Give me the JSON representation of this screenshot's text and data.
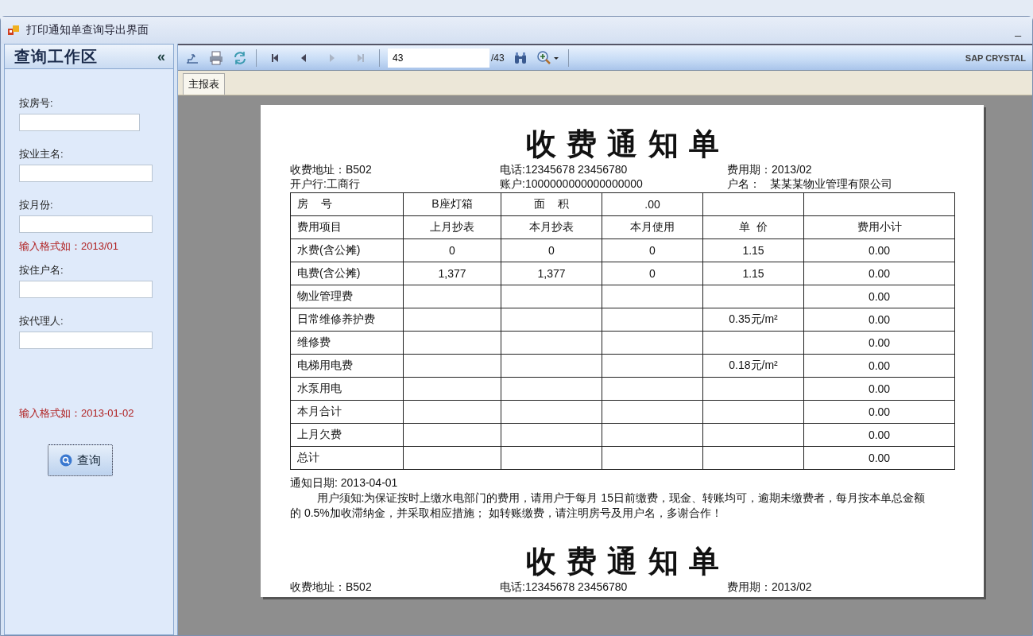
{
  "window": {
    "title": "打印通知单查询导出界面",
    "minimize": "_"
  },
  "sidebar": {
    "title": "查询工作区",
    "collapse": "«",
    "fields": [
      {
        "label": "按房号:"
      },
      {
        "label": "按业主名:"
      },
      {
        "label": "按月份:",
        "hint": "输入格式如：2013/01"
      },
      {
        "label": "按住户名:"
      },
      {
        "label": "按代理人:"
      }
    ],
    "date_hint": "输入格式如：2013-01-02",
    "button": "查询"
  },
  "toolbar": {
    "nav": [
      {
        "kind": "first",
        "disabled": false
      },
      {
        "kind": "prev",
        "disabled": false
      },
      {
        "kind": "next",
        "disabled": true
      },
      {
        "kind": "last",
        "disabled": true
      }
    ],
    "page_value": "43",
    "page_total": "/43",
    "brand": "SAP CRYSTAL"
  },
  "tabs": [
    {
      "label": "主报表",
      "selected": true
    }
  ],
  "pages": [
    {
      "title": "收 费 通 知 单",
      "info": [
        [
          "收费地址：B502",
          "电话:12345678 23456780",
          "费用期：2013/02"
        ],
        [
          "开户行:工商行",
          "账户:1000000000000000000",
          "户名：   某某某物业管理有限公司"
        ]
      ],
      "table": {
        "rows": [
          [
            "房    号",
            "B座灯箱",
            "面    积",
            ".00",
            null,
            null
          ],
          [
            "费用项目",
            "上月抄表",
            "本月抄表",
            "本月使用",
            "单  价",
            "费用小计"
          ],
          [
            "水费(含公摊)",
            "0",
            "0",
            "0",
            "1.15",
            "0.00"
          ],
          [
            "电费(含公摊)",
            "1,377",
            "1,377",
            "0",
            "1.15",
            "0.00"
          ],
          [
            "物业管理费",
            null,
            null,
            null,
            null,
            "0.00"
          ],
          [
            "日常维修养护费",
            null,
            null,
            null,
            "0.35元/m²",
            "0.00"
          ],
          [
            "维修费",
            null,
            null,
            null,
            null,
            "0.00"
          ],
          [
            "电梯用电费",
            null,
            null,
            null,
            "0.18元/m²",
            "0.00"
          ],
          [
            "水泵用电",
            null,
            null,
            null,
            null,
            "0.00"
          ],
          [
            "本月合计",
            null,
            null,
            null,
            null,
            "0.00"
          ],
          [
            "上月欠费",
            null,
            null,
            null,
            null,
            "0.00"
          ],
          [
            "总计",
            null,
            null,
            null,
            null,
            "0.00"
          ]
        ]
      },
      "notice_date": "通知日期:  2013-04-01",
      "notice": "用户须知:为保证按时上缴水电部门的费用，请用户于每月 15日前缴费，现金、转账均可，逾期未缴费者，每月按本单总金额的 0.5%加收滞纳金，并采取相应措施；  如转账缴费，请注明房号及用户名，多谢合作！"
    },
    {
      "title": "收 费 通 知 单",
      "info": [
        [
          "收费地址：B502",
          "电话:12345678 23456780",
          "费用期：2013/02"
        ]
      ]
    }
  ]
}
